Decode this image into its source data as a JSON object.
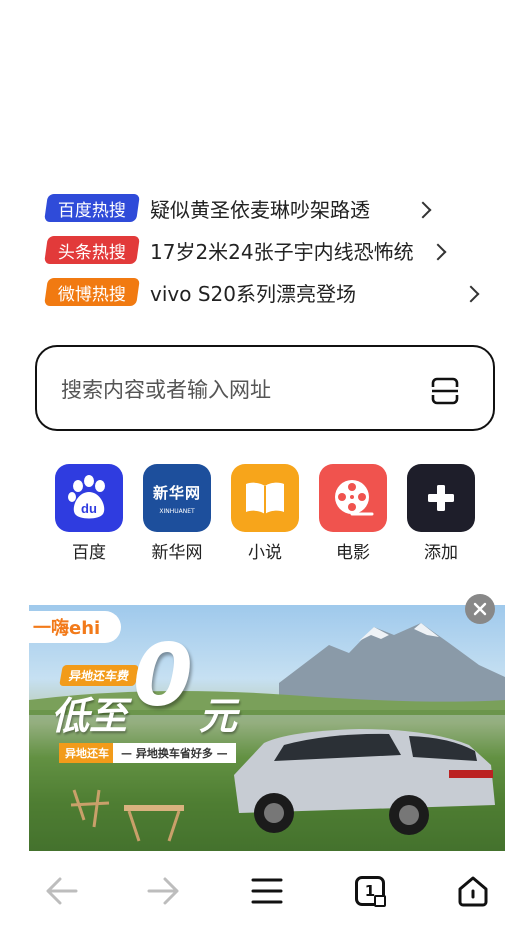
{
  "hot_search": [
    {
      "badge": "百度热搜",
      "badge_color": "#2f4bd9",
      "text": "疑似黄圣依麦琳吵架路透"
    },
    {
      "badge": "头条热搜",
      "badge_color": "#e23a3a",
      "text": "17岁2米24张子宇内线恐怖统"
    },
    {
      "badge": "微博热搜",
      "badge_color": "#f17a11",
      "text": "vivo S20系列漂亮登场"
    }
  ],
  "search": {
    "placeholder": "搜索内容或者输入网址",
    "icon": "scan-icon"
  },
  "shortcuts": [
    {
      "label": "百度",
      "icon": "baidu-paw-icon",
      "color": "#2f3ce0"
    },
    {
      "label": "新华网",
      "icon": "xinhua-logo-icon",
      "color": "#1d4f9c",
      "logo_text": "新华网",
      "logo_sub": "XINHUANET"
    },
    {
      "label": "小说",
      "icon": "book-icon",
      "color": "#f7a51b"
    },
    {
      "label": "电影",
      "icon": "film-reel-icon",
      "color": "#f0534e"
    },
    {
      "label": "添加",
      "icon": "plus-icon",
      "color": "#1e1e2a"
    }
  ],
  "ad": {
    "brand": "一嗨ehi",
    "tag": "异地还车费",
    "headline_pre": "低至",
    "headline_num": "0",
    "headline_post": "元",
    "sub_tag": "异地还车",
    "slogan": "— 异地换车省好多 —",
    "close_icon": "close-icon"
  },
  "toolbar": {
    "back_icon": "back-arrow-icon",
    "forward_icon": "forward-arrow-icon",
    "menu_icon": "menu-icon",
    "tabs_count": "1",
    "home_icon": "home-icon"
  }
}
